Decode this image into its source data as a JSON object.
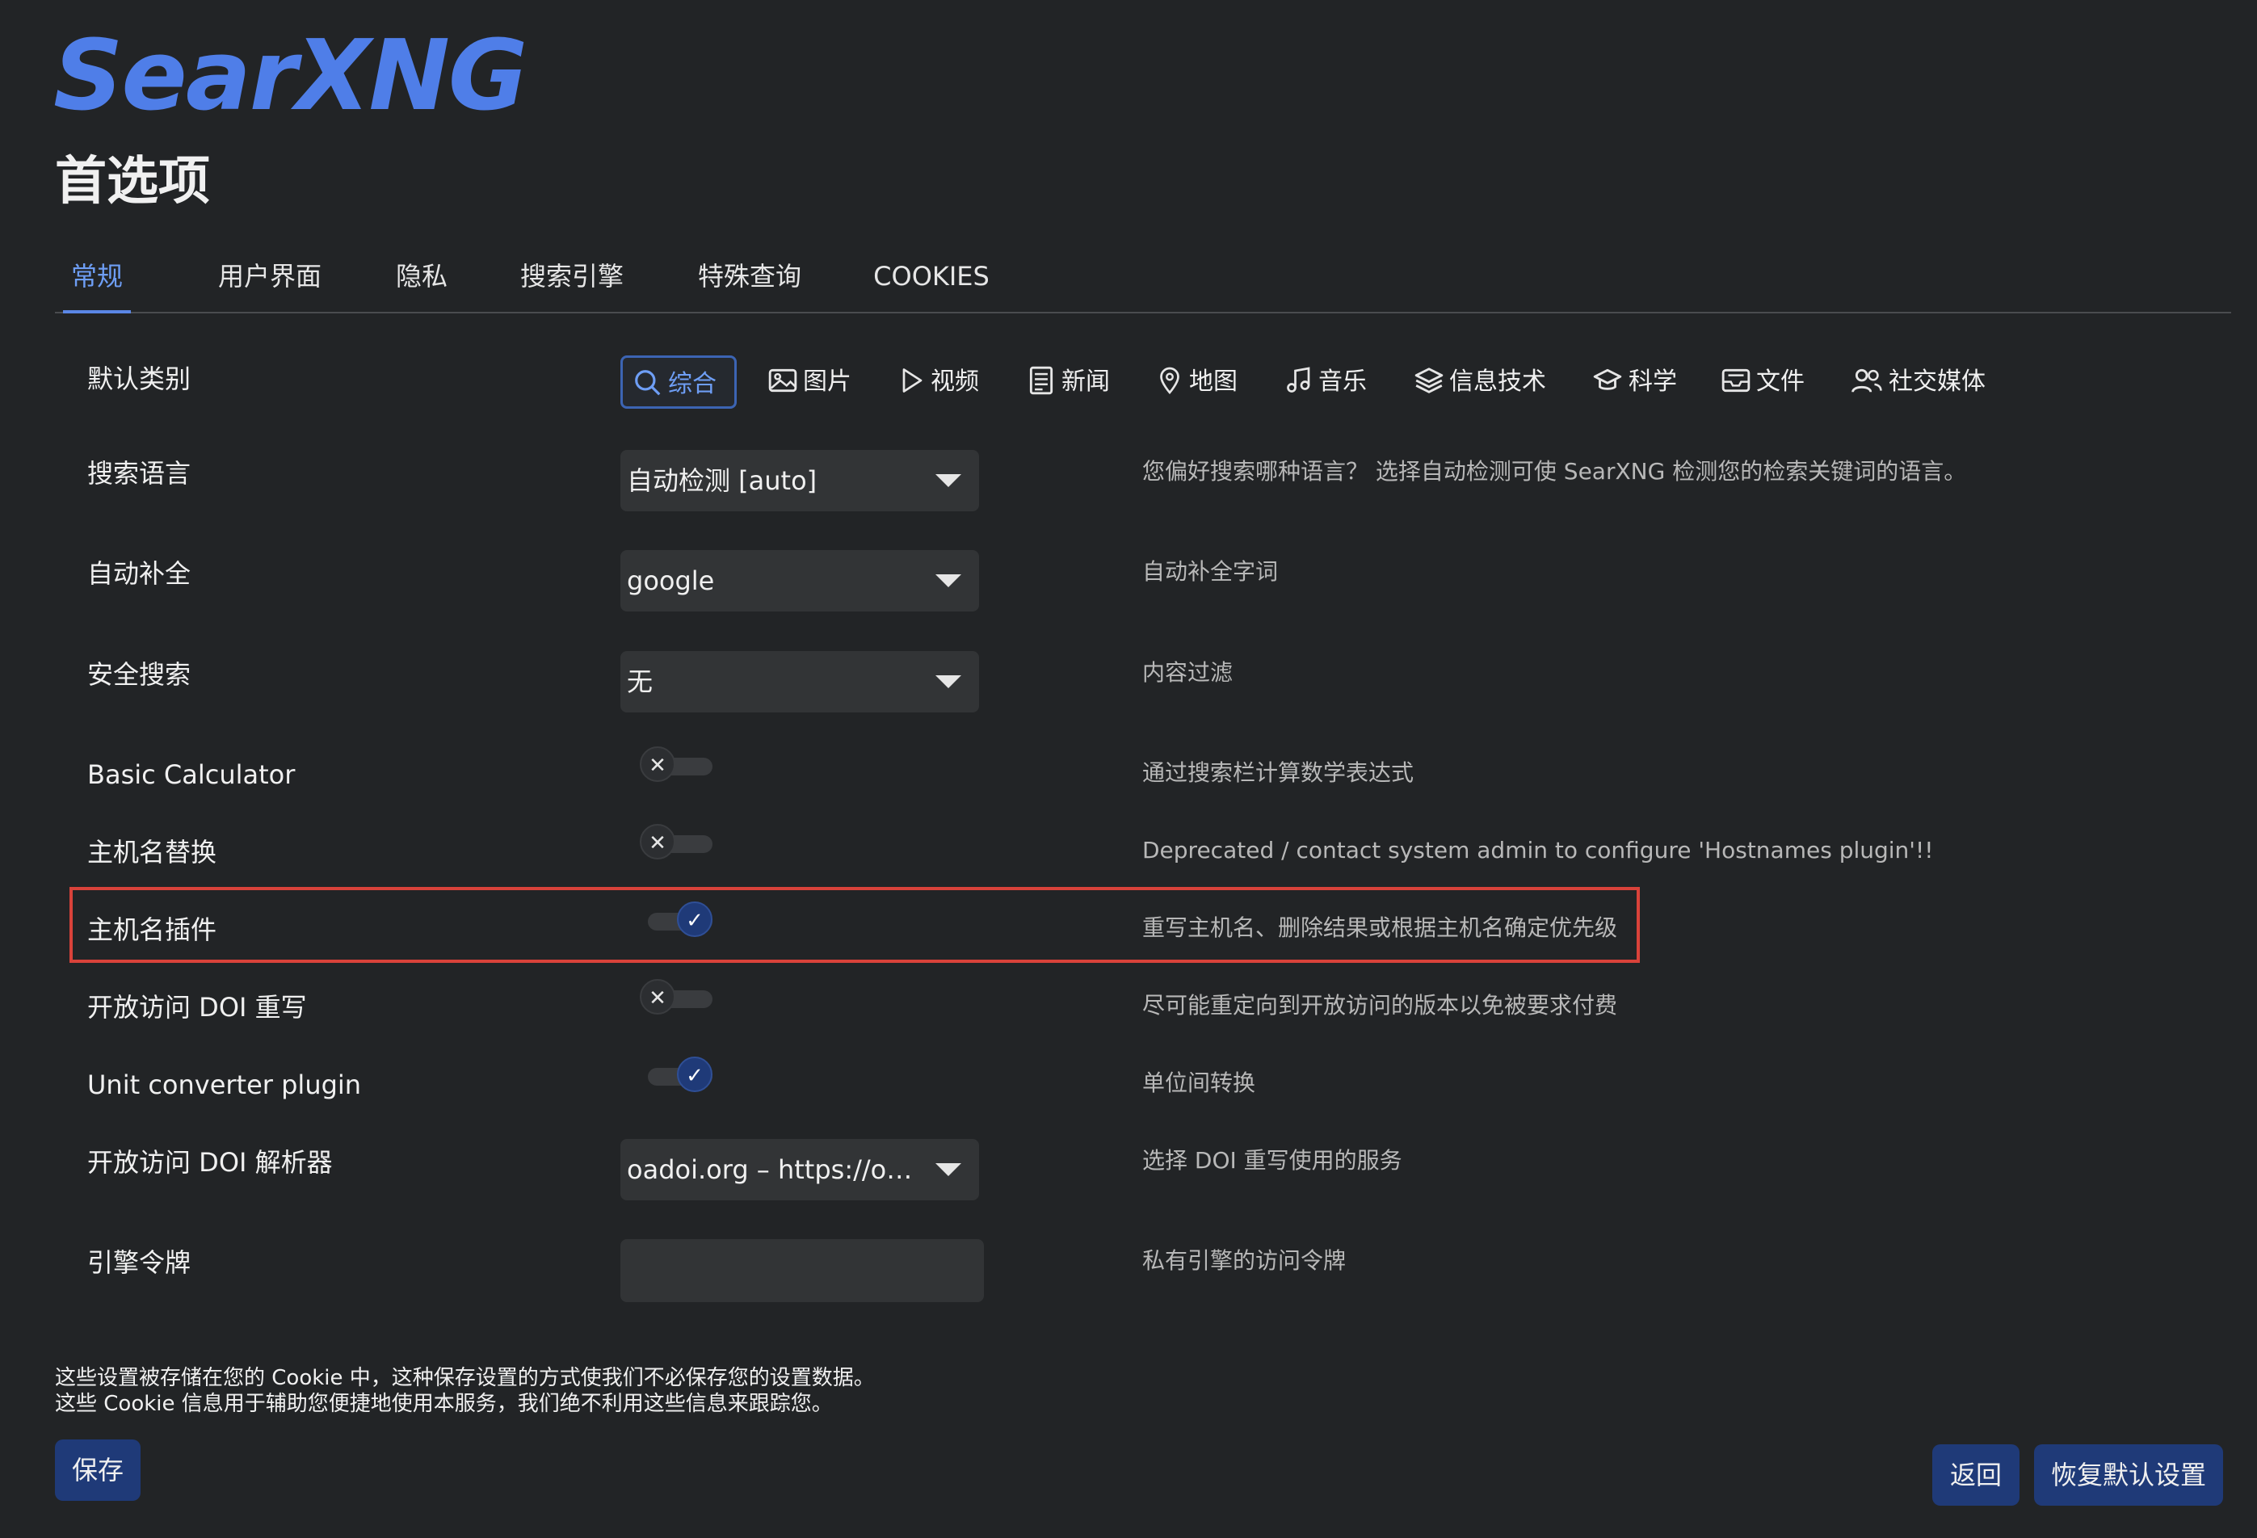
{
  "app": {
    "logo": "SearXNG",
    "page_title": "首选项"
  },
  "tabs": [
    {
      "label": "常规",
      "active": true
    },
    {
      "label": "用户界面"
    },
    {
      "label": "隐私"
    },
    {
      "label": "搜索引擎"
    },
    {
      "label": "特殊查询"
    },
    {
      "label": "COOKIES"
    }
  ],
  "categories": {
    "label": "默认类别",
    "items": [
      {
        "label": "综合",
        "icon": "search-icon",
        "active": true
      },
      {
        "label": "图片",
        "icon": "image-icon"
      },
      {
        "label": "视频",
        "icon": "play-icon"
      },
      {
        "label": "新闻",
        "icon": "newspaper-icon"
      },
      {
        "label": "地图",
        "icon": "map-pin-icon"
      },
      {
        "label": "音乐",
        "icon": "music-note-icon"
      },
      {
        "label": "信息技术",
        "icon": "layers-icon"
      },
      {
        "label": "科学",
        "icon": "graduation-cap-icon"
      },
      {
        "label": "文件",
        "icon": "inbox-icon"
      },
      {
        "label": "社交媒体",
        "icon": "people-icon"
      }
    ]
  },
  "settings": {
    "search_language": {
      "label": "搜索语言",
      "value": "自动检测 [auto]",
      "desc": "您偏好搜索哪种语言？ 选择自动检测可使 SearXNG 检测您的检索关键词的语言。"
    },
    "autocomplete": {
      "label": "自动补全",
      "value": "google",
      "desc": "自动补全字词"
    },
    "safe_search": {
      "label": "安全搜索",
      "value": "无",
      "desc": "内容过滤"
    },
    "basic_calculator": {
      "label": "Basic Calculator",
      "enabled": false,
      "desc": "通过搜索栏计算数学表达式"
    },
    "hostname_replace": {
      "label": "主机名替换",
      "enabled": false,
      "desc": "Deprecated / contact system admin to configure 'Hostnames plugin'!!"
    },
    "hostnames_plugin": {
      "label": "主机名插件",
      "enabled": true,
      "desc": "重写主机名、删除结果或根据主机名确定优先级"
    },
    "oa_doi_rewrite": {
      "label": "开放访问 DOI 重写",
      "enabled": false,
      "desc": "尽可能重定向到开放访问的版本以免被要求付费"
    },
    "unit_converter": {
      "label": "Unit converter plugin",
      "enabled": true,
      "desc": "单位间转换"
    },
    "doi_resolver": {
      "label": "开放访问 DOI 解析器",
      "value": "oadoi.org – https://oa...",
      "desc": "选择 DOI 重写使用的服务"
    },
    "engine_tokens": {
      "label": "引擎令牌",
      "value": "",
      "desc": "私有引擎的访问令牌"
    }
  },
  "toggle_marks": {
    "off": "✕",
    "on": "✓"
  },
  "footer": {
    "note_line1": "这些设置被存储在您的 Cookie 中，这种保存设置的方式使我们不必保存您的设置数据。",
    "note_line2": "这些 Cookie 信息用于辅助您便捷地使用本服务，我们绝不利用这些信息来跟踪您。",
    "save_label": "保存",
    "back_label": "返回",
    "reset_label": "恢复默认设置"
  },
  "colors": {
    "accent": "#4f7ee8",
    "highlight_border": "#d9423a",
    "button_bg": "#1f3a78",
    "background": "#222426"
  }
}
